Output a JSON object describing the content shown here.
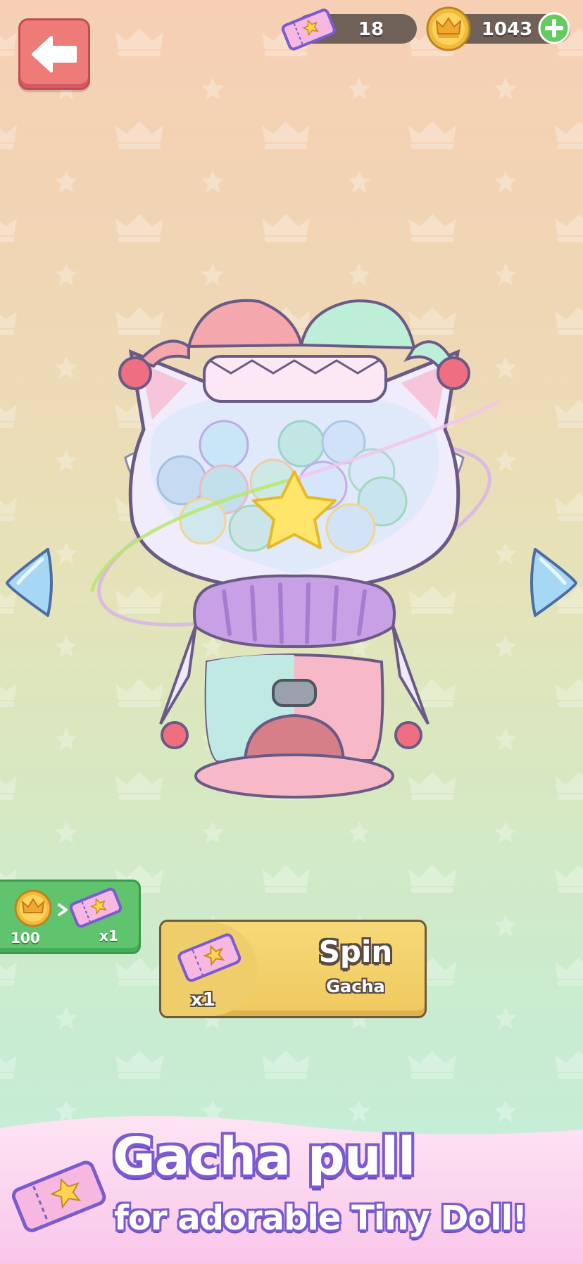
{
  "header": {
    "tickets": "18",
    "coins": "1043"
  },
  "icons": {
    "back": "back-arrow-icon",
    "ticket": "ticket-icon",
    "coin": "crown-coin-icon",
    "plus": "plus-icon"
  },
  "exchange": {
    "coin_cost": "100",
    "ticket_amount": "x1"
  },
  "spin": {
    "label": "Spin",
    "sublabel": "Gacha",
    "cost": "x1"
  },
  "banner": {
    "title": "Gacha pull",
    "subtitle": "for adorable Tiny Doll!"
  },
  "colors": {
    "back_button": "#ef7b78",
    "exchange_button": "#5fc46d",
    "spin_button": "#f0c95e",
    "banner_outline": "#7a5bd0"
  }
}
